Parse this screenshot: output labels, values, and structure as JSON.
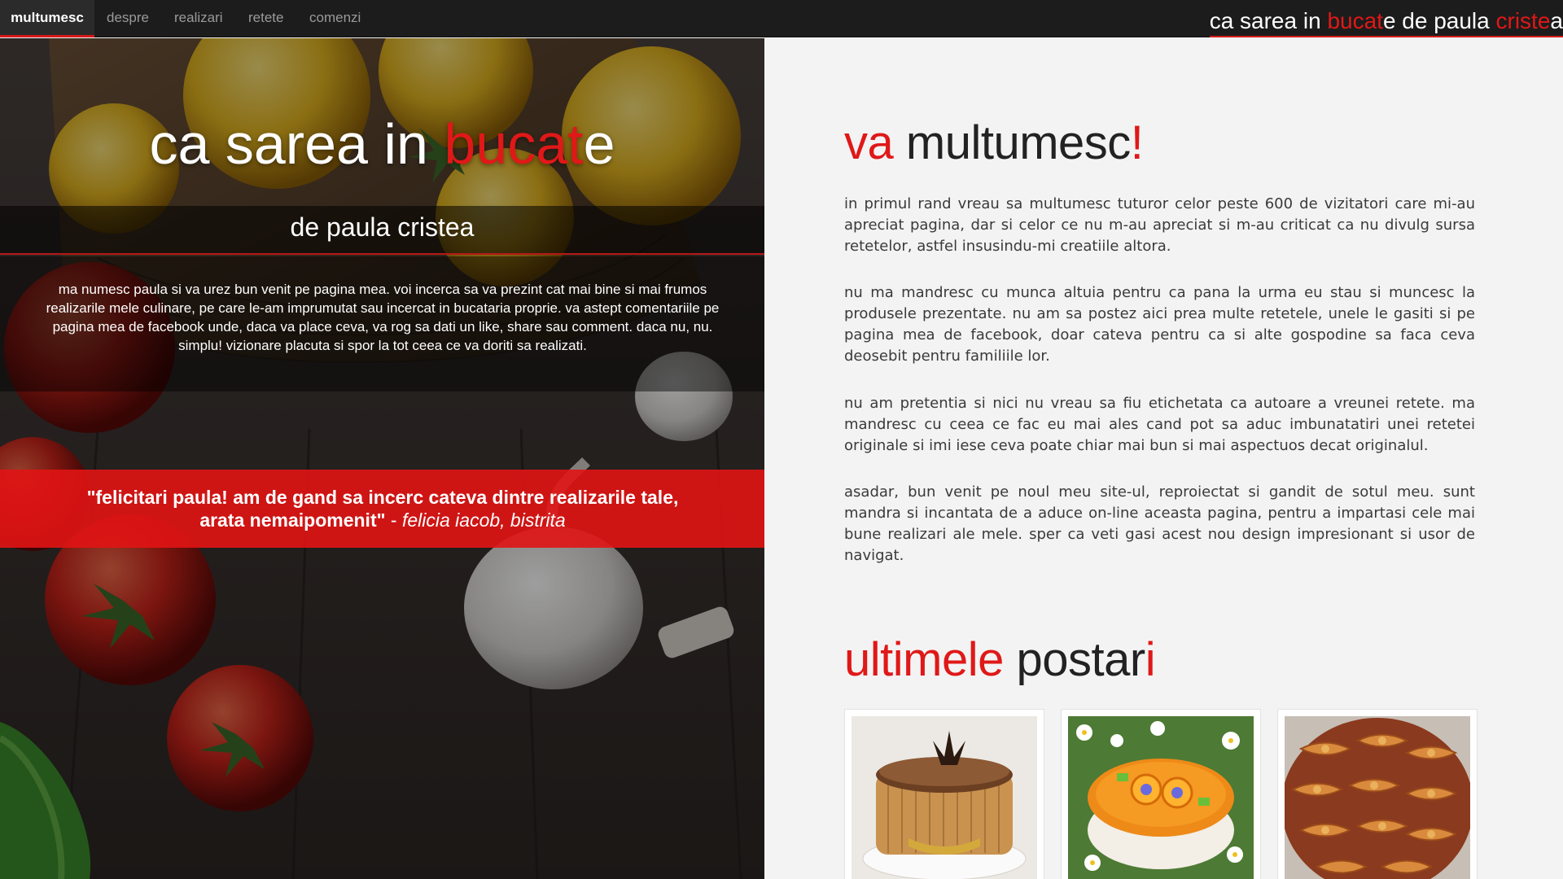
{
  "nav": {
    "items": [
      "multumesc",
      "despre",
      "realizari",
      "retete",
      "comenzi"
    ],
    "active": "multumesc",
    "brand": {
      "p1": "ca sarea in ",
      "p2": "bucat",
      "p3": "e de paula ",
      "p4": "criste",
      "p5": "a"
    }
  },
  "hero": {
    "title": {
      "p1": "ca sarea in ",
      "p2": "bucat",
      "p3": "e"
    },
    "subtitle": "de paula cristea",
    "intro": "ma numesc paula si va urez bun venit pe pagina mea. voi incerca sa va prezint cat mai bine si mai frumos realizarile mele culinare, pe care le-am imprumutat sau incercat in bucataria proprie. va astept comentariile pe pagina mea de facebook unde, daca va place ceva, va rog sa dati un like, share sau comment. daca nu, nu. simplu! vizionare placuta si spor la tot ceea ce va doriti sa realizati.",
    "quote": {
      "text": "\"felicitari paula! am de gand sa incerc cateva dintre realizarile tale, arata nemaipomenit\"",
      "separator": " - ",
      "author": "felicia iacob, bistrita"
    }
  },
  "main": {
    "thanks_heading": {
      "p1": "va",
      "p2": " multumesc",
      "p3": "!"
    },
    "paragraphs": [
      "in primul rand vreau sa multumesc tuturor celor peste 600 de vizitatori care mi-au apreciat pagina, dar si celor ce nu m-au apreciat si m-au criticat ca nu divulg sursa retetelor, astfel insusindu-mi creatiile altora.",
      "nu ma mandresc cu munca altuia pentru ca pana la urma eu stau si muncesc la produsele prezentate. nu am sa postez aici prea multe retetele, unele le gasiti si pe pagina mea de facebook, doar cateva pentru ca si alte gospodine sa faca ceva deosebit pentru familiile lor.",
      "nu am pretentia si nici nu vreau sa fiu etichetata ca autoare a vreunei retete. ma mandresc cu ceea ce fac eu mai ales cand pot sa aduc imbunatatiri unei retetei originale si imi iese ceva poate chiar mai bun si mai aspectuos decat originalul.",
      "asadar, bun venit pe noul meu site-ul, reproiectat si gandit de sotul meu. sunt mandra si incantata de a aduce on-line aceasta pagina, pentru a impartasi cele mai bune realizari ale mele. sper ca veti gasi acest nou design impresionant si usor de navigat."
    ],
    "posts_heading": {
      "p1": "ultimele",
      "p2": " postar",
      "p3": "i"
    },
    "posts": [
      {
        "icon": "tiramisu-cake-photo"
      },
      {
        "icon": "orange-cake-photo"
      },
      {
        "icon": "pastry-rolls-photo"
      }
    ]
  },
  "colors": {
    "accent": "#e01818",
    "navbar": "#1c1c1c",
    "quote_band": "#e11414",
    "text": "#3a3a3a"
  }
}
